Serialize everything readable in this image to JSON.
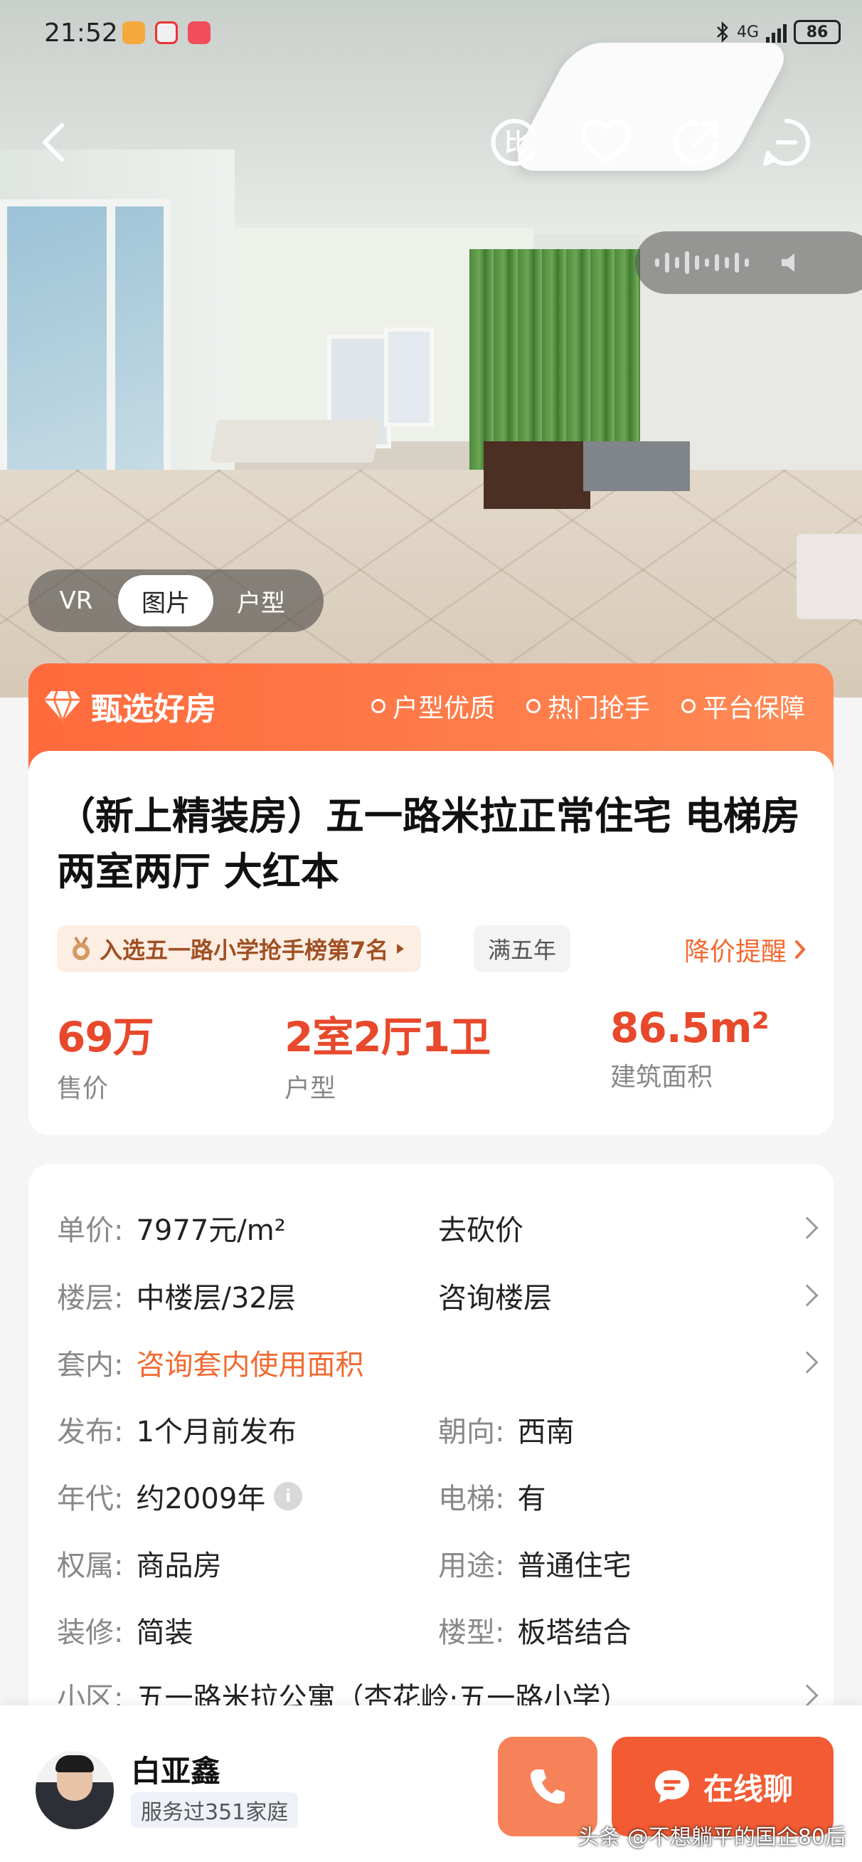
{
  "status_bar": {
    "time": "21:52",
    "network": "4G",
    "battery": "86",
    "icons": [
      "bluetooth-icon",
      "signal-icon",
      "battery-icon"
    ]
  },
  "hero": {
    "media_tabs": [
      {
        "label": "VR",
        "active": false
      },
      {
        "label": "图片",
        "active": true
      },
      {
        "label": "户型",
        "active": false
      }
    ],
    "actions": [
      "back-icon",
      "compare-icon",
      "favorite-icon",
      "share-icon",
      "more-icon"
    ]
  },
  "banner": {
    "title": "甄选好房",
    "tags": [
      "户型优质",
      "热门抢手",
      "平台保障"
    ]
  },
  "listing": {
    "title": "（新上精装房）五一路米拉正常住宅 电梯房 两室两厅 大红本",
    "rank_badge": "入选五一路小学抢手榜第7名",
    "year_badge": "满五年",
    "price_alert": "降价提醒",
    "stats": [
      {
        "value": "69万",
        "label": "售价"
      },
      {
        "value": "2室2厅1卫",
        "label": "户型"
      },
      {
        "value": "86.5m²",
        "label": "建筑面积"
      }
    ]
  },
  "details": {
    "unit_price": {
      "label": "单价:",
      "value": "7977元/m²",
      "action": "去砍价"
    },
    "floor": {
      "label": "楼层:",
      "value": "中楼层/32层",
      "action": "咨询楼层"
    },
    "inner": {
      "label": "套内:",
      "value": "咨询套内使用面积"
    },
    "publish": {
      "label": "发布:",
      "value": "1个月前发布"
    },
    "orientation": {
      "label": "朝向:",
      "value": "西南"
    },
    "year": {
      "label": "年代:",
      "value": "约2009年"
    },
    "elevator": {
      "label": "电梯:",
      "value": "有"
    },
    "ownership": {
      "label": "权属:",
      "value": "商品房"
    },
    "usage": {
      "label": "用途:",
      "value": "普通住宅"
    },
    "decoration": {
      "label": "装修:",
      "value": "简装"
    },
    "building_type": {
      "label": "楼型:",
      "value": "板塔结合"
    },
    "community": {
      "label": "小区:",
      "value": "五一路米拉公寓（杏花岭·五一路小学）"
    }
  },
  "agent": {
    "name": "白亚鑫",
    "served": "服务过351家庭"
  },
  "actions": {
    "chat": "在线聊"
  },
  "watermark": "头条 @不想躺平的国企80后",
  "colors": {
    "accent": "#f26a32",
    "price": "#e8482b",
    "banner_start": "#ff6a3c",
    "banner_end": "#ff8a55",
    "chat_button": "#f25b33",
    "call_button": "#f7825a"
  }
}
